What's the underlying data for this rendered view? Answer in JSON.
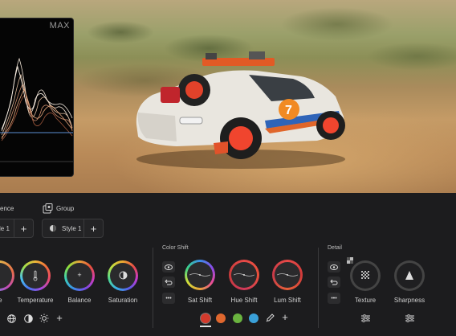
{
  "histogram": {
    "max_label": "MAX"
  },
  "panel": {
    "reference_title": "ence",
    "group_title": "Group",
    "reference_style": "le 1",
    "group_style": "Style 1",
    "plus": "+",
    "color_shift_title": "Color Shift",
    "detail_title": "Detail",
    "knobs": {
      "partial": "re",
      "temperature": "Temperature",
      "balance": "Balance",
      "saturation": "Saturation",
      "sat_shift": "Sat Shift",
      "hue_shift": "Hue Shift",
      "lum_shift": "Lum Shift",
      "texture": "Texture",
      "sharpness": "Sharpness"
    },
    "balance_symbol": "+",
    "swatch_colors": [
      "#d33a2c",
      "#e0672e",
      "#6ab33f",
      "#3aa0d8"
    ],
    "more": "•••"
  }
}
